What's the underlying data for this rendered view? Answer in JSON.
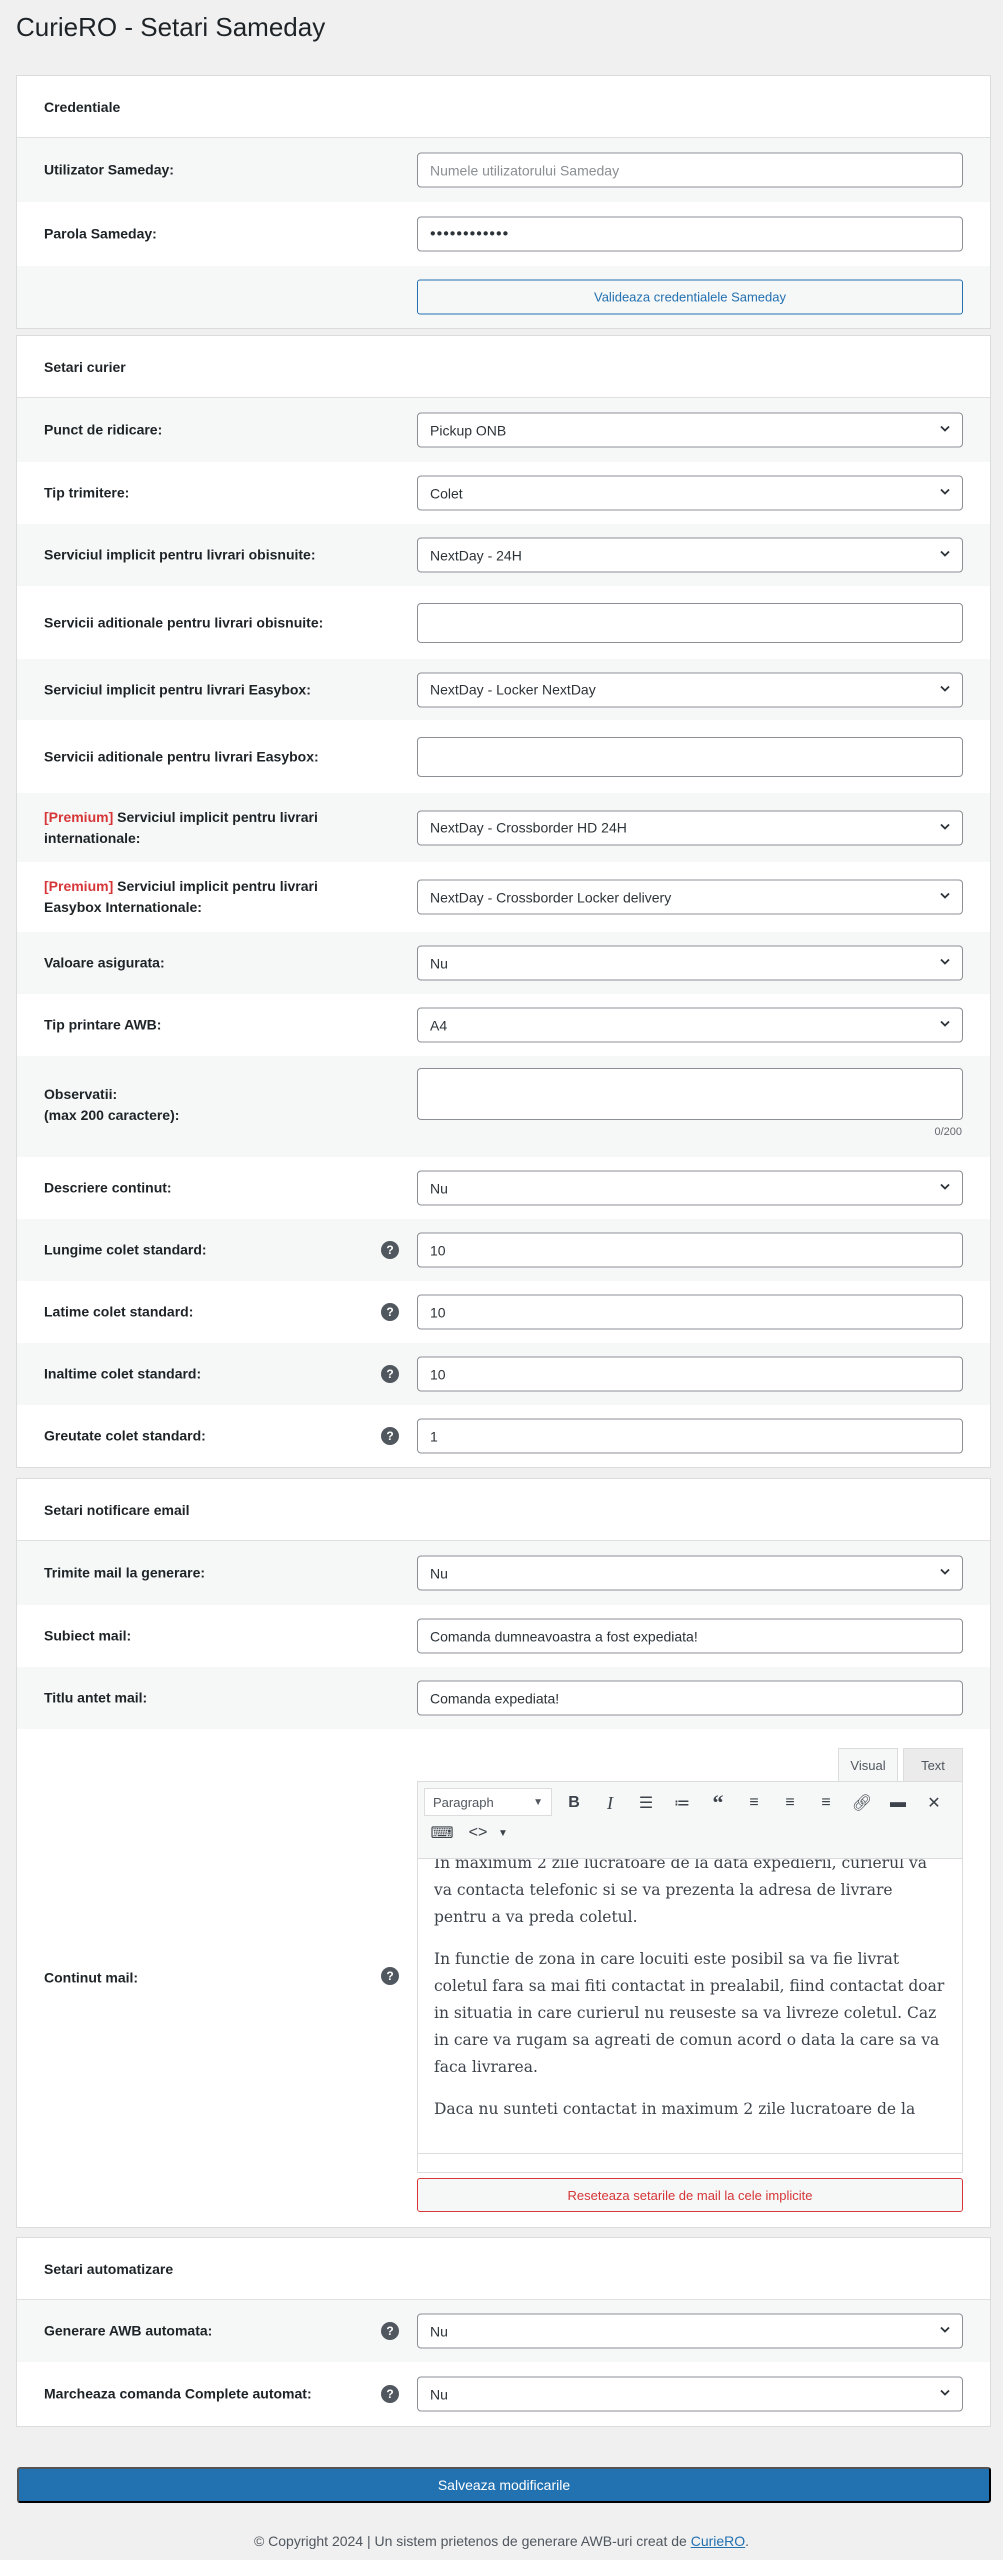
{
  "title": "CurieRO - Setari Sameday",
  "sections": [
    {
      "title": "Credentiale",
      "rows": [
        {
          "label": "Utilizator Sameday:",
          "type": "text",
          "placeholder": "Numele utilizatorului Sameday",
          "value": ""
        },
        {
          "label": "Parola Sameday:",
          "type": "password",
          "value": "••••••••••••"
        },
        {
          "label": "",
          "type": "button",
          "button": "Valideaza credentialele Sameday"
        }
      ]
    },
    {
      "title": "Setari curier",
      "rows": [
        {
          "label": "Punct de ridicare:",
          "type": "select",
          "value": "Pickup ONB"
        },
        {
          "label": "Tip trimitere:",
          "type": "select",
          "value": "Colet"
        },
        {
          "label": "Serviciul implicit pentru livrari obisnuite:",
          "type": "select",
          "value": "NextDay - 24H"
        },
        {
          "label": "Servicii aditionale pentru livrari obisnuite:",
          "type": "multiselect",
          "value": ""
        },
        {
          "label": "Serviciul implicit pentru livrari Easybox:",
          "type": "select",
          "value": "NextDay - Locker NextDay"
        },
        {
          "label": "Servicii aditionale pentru livrari Easybox:",
          "type": "multiselect",
          "value": ""
        },
        {
          "premium": "[Premium]",
          "label": " Serviciul implicit pentru livrari internationale:",
          "type": "select",
          "value": "NextDay - Crossborder HD 24H"
        },
        {
          "premium": "[Premium]",
          "label": " Serviciul implicit pentru livrari Easybox Internationale:",
          "type": "select",
          "value": "NextDay - Crossborder Locker delivery"
        },
        {
          "label": "Valoare asigurata:",
          "type": "select",
          "value": "Nu"
        },
        {
          "label": "Tip printare AWB:",
          "type": "select",
          "value": "A4"
        },
        {
          "label": "Observatii:",
          "label2": "(max 200 caractere):",
          "type": "textarea",
          "value": "",
          "counter": "0/200"
        },
        {
          "label": "Descriere continut:",
          "type": "select",
          "value": "Nu"
        },
        {
          "label": "Lungime colet standard:",
          "type": "text",
          "value": "10",
          "help": true
        },
        {
          "label": "Latime colet standard:",
          "type": "text",
          "value": "10",
          "help": true
        },
        {
          "label": "Inaltime colet standard:",
          "type": "text",
          "value": "10",
          "help": true
        },
        {
          "label": "Greutate colet standard:",
          "type": "text",
          "value": "1",
          "help": true
        }
      ]
    },
    {
      "title": "Setari notificare email",
      "rows": [
        {
          "label": "Trimite mail la generare:",
          "type": "select",
          "value": "Nu"
        },
        {
          "label": "Subiect mail:",
          "type": "text",
          "value": "Comanda dumneavoastra a fost expediata!"
        },
        {
          "label": "Titlu antet mail:",
          "type": "text",
          "value": "Comanda expediata!"
        },
        {
          "label": "Continut mail:",
          "type": "editor",
          "help": true,
          "button": "Reseteaza setarile de mail la cele implicite"
        }
      ]
    },
    {
      "title": "Setari automatizare",
      "rows": [
        {
          "label": "Generare AWB automata:",
          "type": "select",
          "value": "Nu",
          "help": true
        },
        {
          "label": "Marcheaza comanda Complete automat:",
          "type": "select",
          "value": "Nu",
          "help": true
        }
      ]
    }
  ],
  "editor": {
    "tabs": [
      "Visual",
      "Text"
    ],
    "active_tab": "Visual",
    "format": "Paragraph",
    "toolbar_icons": [
      "bold-icon",
      "italic-icon",
      "bullet-list-icon",
      "numbered-list-icon",
      "blockquote-icon",
      "align-left-icon",
      "align-center-icon",
      "align-right-icon",
      "link-icon",
      "read-more-icon",
      "fullscreen-icon",
      "keyboard-icon",
      "code-icon"
    ],
    "paragraphs": [
      "In maximum 2 zile lucratoare de la data expedierii, curierul va va contacta telefonic si se va prezenta la adresa de livrare pentru a va preda coletul.",
      "In functie de zona in care locuiti este posibil sa va fie livrat coletul fara sa mai fiti contactat in prealabil, fiind contactat doar in situatia in care curierul nu reuseste sa va livreze coletul. Caz in care va rugam sa agreati de comun acord o data la care sa va faca livrarea.",
      "Daca nu sunteti contactat in maximum 2 zile lucratoare de la"
    ]
  },
  "save_button": "Salveaza modificarile",
  "footer": {
    "text": "© Copyright 2024 | Un sistem prietenos de generare AWB-uri creat de ",
    "link": "CurieRO",
    "end": "."
  },
  "colors": {
    "primary": "#2271b1",
    "danger": "#d63638",
    "background": "#f0f0f1"
  }
}
